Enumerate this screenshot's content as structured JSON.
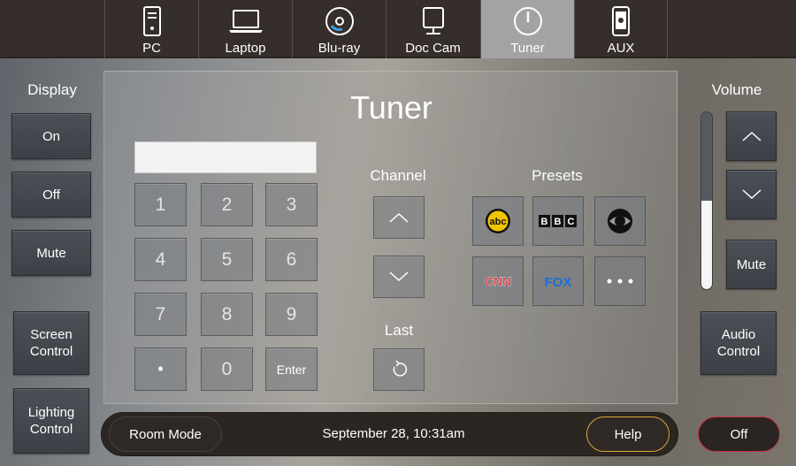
{
  "sources": [
    {
      "label": "PC",
      "icon": "pc-tower-icon",
      "active": false
    },
    {
      "label": "Laptop",
      "icon": "laptop-icon",
      "active": false
    },
    {
      "label": "Blu-ray",
      "icon": "disc-icon",
      "active": false
    },
    {
      "label": "Doc Cam",
      "icon": "doc-cam-icon",
      "active": false
    },
    {
      "label": "Tuner",
      "icon": "tuner-knob-icon",
      "active": true
    },
    {
      "label": "AUX",
      "icon": "aux-device-icon",
      "active": false
    }
  ],
  "display": {
    "title": "Display",
    "on": "On",
    "off": "Off",
    "mute": "Mute",
    "screen_control": "Screen Control",
    "lighting_control": "Lighting Control"
  },
  "volume": {
    "title": "Volume",
    "mute": "Mute",
    "audio_control": "Audio Control",
    "level_percent": 50
  },
  "tuner": {
    "title": "Tuner",
    "entry_value": "",
    "keys": [
      "1",
      "2",
      "3",
      "4",
      "5",
      "6",
      "7",
      "8",
      "9",
      "•",
      "0",
      "Enter"
    ],
    "channel_label": "Channel",
    "last_label": "Last",
    "presets_label": "Presets",
    "presets": [
      {
        "name": "abc",
        "icon": "abc-logo-icon"
      },
      {
        "name": "BBC",
        "icon": "bbc-logo-icon"
      },
      {
        "name": "CBS",
        "icon": "cbs-eye-logo-icon"
      },
      {
        "name": "CNN",
        "icon": "cnn-logo-icon"
      },
      {
        "name": "FOX",
        "icon": "fox-logo-icon"
      },
      {
        "name": "•••",
        "icon": "more-icon"
      }
    ]
  },
  "bottom": {
    "room_mode": "Room Mode",
    "datetime": "September 28,  10:31am",
    "help": "Help",
    "off": "Off"
  },
  "colors": {
    "help_border": "#d9a53a",
    "off_border": "#c8324a",
    "fox_blue": "#1a6fd1",
    "cnn_red": "#d3202a"
  }
}
